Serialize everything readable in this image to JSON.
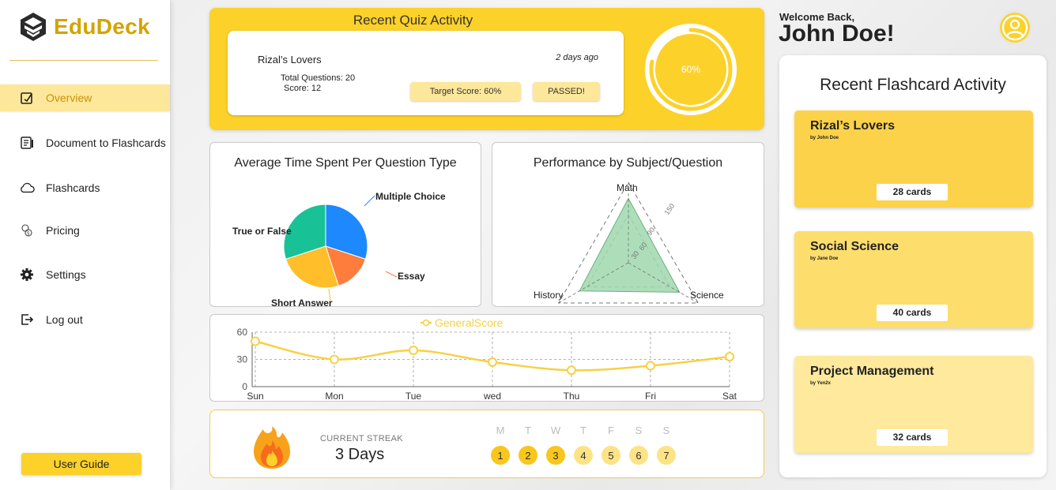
{
  "brand": {
    "name": "EduDeck"
  },
  "sidebar": {
    "items": [
      {
        "label": "Overview",
        "icon": "edit-square-icon",
        "active": true
      },
      {
        "label": "Document to Flashcards",
        "icon": "document-icon",
        "active": false
      },
      {
        "label": "Flashcards",
        "icon": "cloud-icon",
        "active": false
      },
      {
        "label": "Pricing",
        "icon": "coins-icon",
        "active": false
      },
      {
        "label": "Settings",
        "icon": "gear-icon",
        "active": false
      },
      {
        "label": "Log out",
        "icon": "logout-icon",
        "active": false
      }
    ],
    "user_guide": "User Guide"
  },
  "quiz": {
    "title": "Recent Quiz Activity",
    "name": "Rizal’s Lovers",
    "time_ago": "2 days ago",
    "total_questions": "Total Questions: 20",
    "score": "Score: 12",
    "target": "Target Score: 60%",
    "status": "PASSED!",
    "progress_label": "60%",
    "progress_value": 0.6
  },
  "pie_panel": {
    "title": "Average Time Spent Per Question Type",
    "chart_data": {
      "type": "pie",
      "labels": [
        "Multiple Choice",
        "Essay",
        "Short Answer",
        "True or False"
      ],
      "values": [
        30,
        15,
        25,
        30
      ],
      "colors": [
        "#1e88ff",
        "#ff7d3c",
        "#ffbe2a",
        "#19c296"
      ]
    }
  },
  "radar_panel": {
    "title": "Performance by Subject/Question",
    "chart_data": {
      "type": "radar",
      "axes": [
        "Math",
        "Science",
        "History"
      ],
      "max": 150,
      "tick_labels": [
        "30",
        "60",
        "90",
        "150"
      ],
      "values": [
        120,
        110,
        105
      ]
    }
  },
  "line_panel": {
    "chart_data": {
      "type": "line",
      "series_name": "GeneralScore",
      "categories": [
        "Sun",
        "Mon",
        "Tue",
        "wed",
        "Thu",
        "Fri",
        "Sat"
      ],
      "values": [
        50,
        30,
        40,
        27,
        18,
        23,
        33
      ],
      "yticks": [
        "0",
        "30",
        "60"
      ],
      "ylim": [
        0,
        60
      ],
      "color": "#f7d046"
    }
  },
  "streak": {
    "caption": "CURRENT STREAK",
    "value": "3 Days",
    "days": [
      {
        "letter": "M",
        "num": "1",
        "done": true
      },
      {
        "letter": "T",
        "num": "2",
        "done": true
      },
      {
        "letter": "W",
        "num": "3",
        "done": true
      },
      {
        "letter": "T",
        "num": "4",
        "done": false
      },
      {
        "letter": "F",
        "num": "5",
        "done": false
      },
      {
        "letter": "S",
        "num": "6",
        "done": false
      },
      {
        "letter": "S",
        "num": "7",
        "done": false
      }
    ]
  },
  "user": {
    "welcome": "Welcome Back,",
    "name": "John Doe!"
  },
  "flashcards": {
    "title": "Recent Flashcard Activity",
    "cards": [
      {
        "title": "Rizal’s Lovers",
        "author": "by John Doe",
        "count": "28 cards",
        "color": "#fcd24a"
      },
      {
        "title": "Social Science",
        "author": "by Jane Doe",
        "count": "40 cards",
        "color": "#fddd6c"
      },
      {
        "title": "Project Management",
        "author": "by Yen2x",
        "count": "32 cards",
        "color": "#fee99c"
      }
    ]
  }
}
